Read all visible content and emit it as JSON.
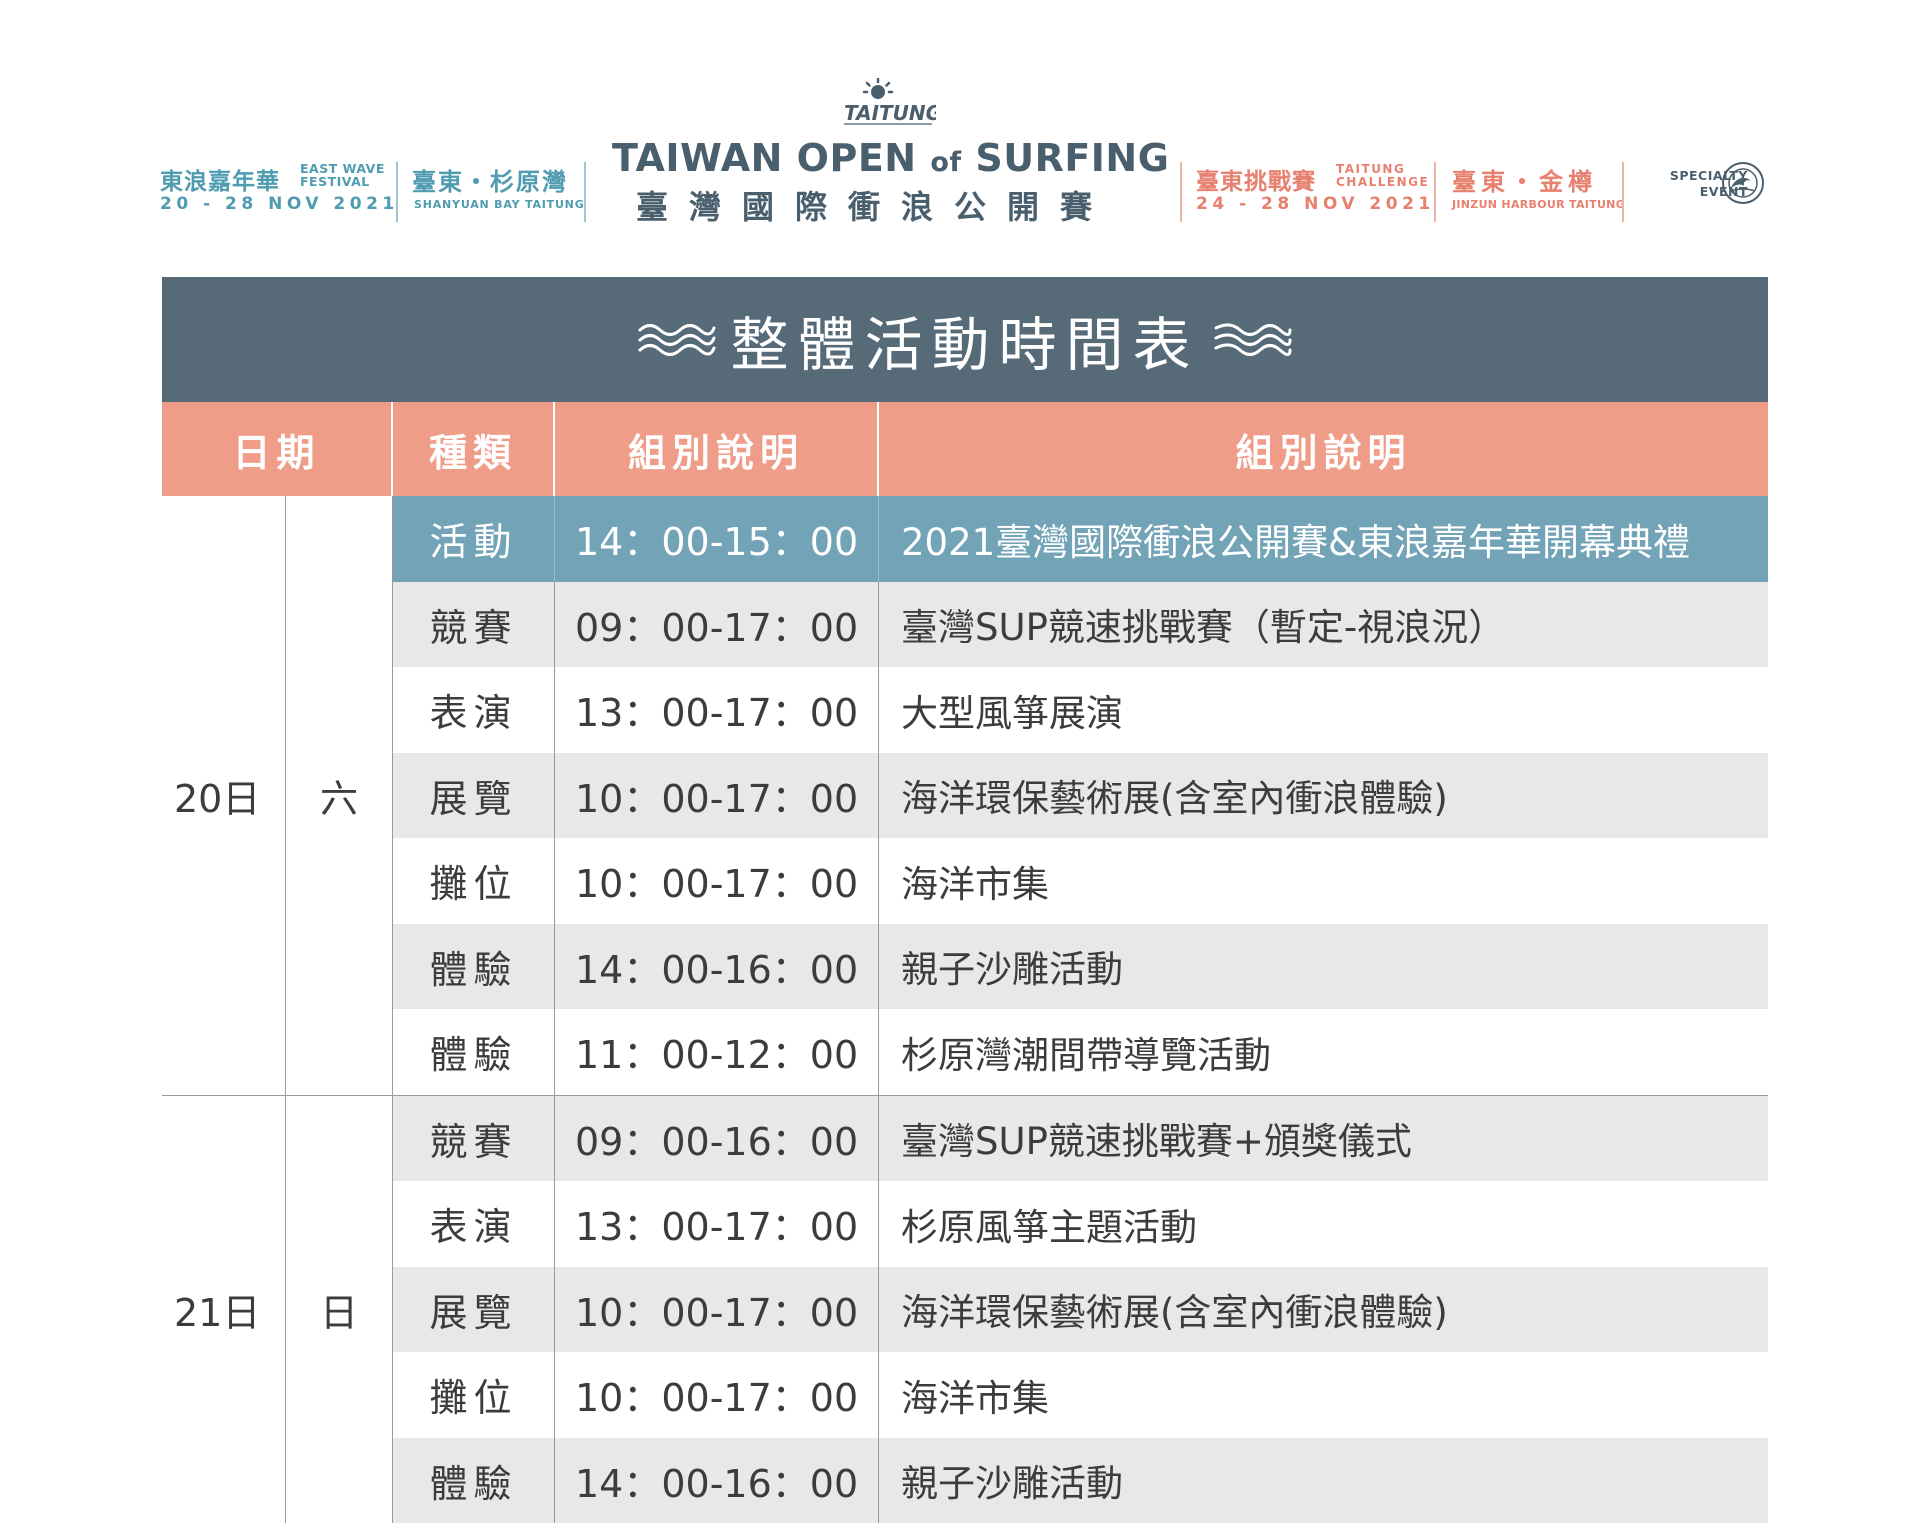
{
  "header": {
    "east_wave": {
      "name_zh": "東浪嘉年華",
      "name_en_line1": "EAST WAVE",
      "name_en_line2": "FESTIVAL",
      "dates": "20 - 28 NOV 2021",
      "venue_zh": "臺東・杉原灣",
      "venue_en": "SHANYUAN BAY TAITUNG"
    },
    "main_title": {
      "logo_text": "TAITUNG",
      "en_part1": "TAIWAN OPEN ",
      "en_of": "of",
      "en_part2": " SURFING",
      "zh": "臺灣國際衝浪公開賽"
    },
    "challenge": {
      "name_zh": "臺東挑戰賽",
      "name_en_line1": "TAITUNG",
      "name_en_line2": "CHALLENGE",
      "dates": "24 - 28 NOV 2021",
      "venue_zh": "臺東・金樽",
      "venue_en": "JINZUN HARBOUR TAITUNG"
    },
    "specialty": {
      "line1": "SPECIALTY",
      "line2": "EVENT"
    },
    "colors": {
      "teal": "#4f9cb1",
      "coral": "#e8806f",
      "slate": "#4a5f6e"
    }
  },
  "table": {
    "title": "整體活動時間表",
    "banner_color": "#566a78",
    "header_color": "#ef9d89",
    "highlight_color": "#72a3b7",
    "columns": [
      "日期",
      "種類",
      "組別說明",
      "組別說明"
    ],
    "groups": [
      {
        "date": "20日",
        "day": "六",
        "rows": [
          {
            "type": "活動",
            "time": "14：00-15：00",
            "desc": "2021臺灣國際衝浪公開賽&東浪嘉年華開幕典禮",
            "style": "hl"
          },
          {
            "type": "競賽",
            "time": "09：00-17：00",
            "desc": "臺灣SUP競速挑戰賽（暫定-視浪況）",
            "style": "alt"
          },
          {
            "type": "表演",
            "time": "13：00-17：00",
            "desc": "大型風箏展演",
            "style": "plain"
          },
          {
            "type": "展覽",
            "time": "10：00-17：00",
            "desc": "海洋環保藝術展(含室內衝浪體驗)",
            "style": "alt"
          },
          {
            "type": "攤位",
            "time": "10：00-17：00",
            "desc": "海洋市集",
            "style": "plain"
          },
          {
            "type": "體驗",
            "time": "14：00-16：00",
            "desc": "親子沙雕活動",
            "style": "alt"
          },
          {
            "type": "體驗",
            "time": "11：00-12：00",
            "desc": "杉原灣潮間帶導覽活動",
            "style": "plain"
          }
        ]
      },
      {
        "date": "21日",
        "day": "日",
        "rows": [
          {
            "type": "競賽",
            "time": "09：00-16：00",
            "desc": "臺灣SUP競速挑戰賽+頒獎儀式",
            "style": "alt"
          },
          {
            "type": "表演",
            "time": "13：00-17：00",
            "desc": "杉原風箏主題活動",
            "style": "plain"
          },
          {
            "type": "展覽",
            "time": "10：00-17：00",
            "desc": "海洋環保藝術展(含室內衝浪體驗)",
            "style": "alt"
          },
          {
            "type": "攤位",
            "time": "10：00-17：00",
            "desc": "海洋市集",
            "style": "plain"
          },
          {
            "type": "體驗",
            "time": "14：00-16：00",
            "desc": "親子沙雕活動",
            "style": "alt"
          }
        ]
      }
    ]
  }
}
